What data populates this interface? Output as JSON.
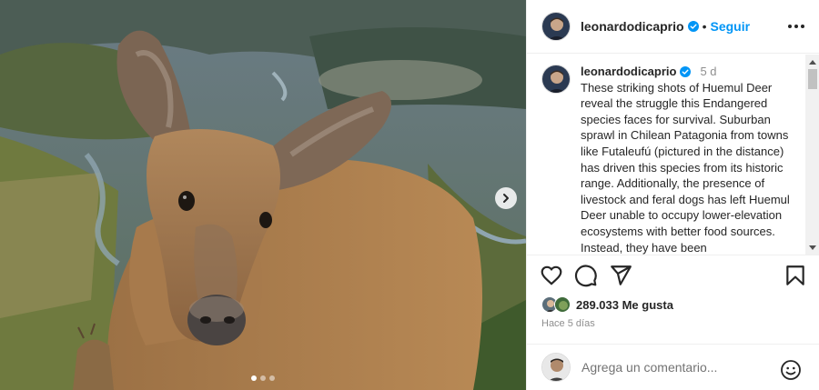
{
  "post": {
    "carousel": {
      "slides": 3,
      "active_index": 0
    }
  },
  "header": {
    "username": "leonardodicaprio",
    "separator": "•",
    "follow_label": "Seguir"
  },
  "caption": {
    "username": "leonardodicaprio",
    "age": "5 d",
    "text": "These striking shots of Huemul Deer reveal the struggle this Endangered species faces for survival. Suburban sprawl in Chilean Patagonia from towns like Futaleufú (pictured in the distance) has driven this species from its historic range. Additionally, the presence of livestock and feral dogs has left Huemul Deer unable to occupy lower-elevation ecosystems with better food sources. Instead, they have been"
  },
  "actions": {
    "icons": [
      "heart-icon",
      "comment-icon",
      "share-icon",
      "bookmark-icon"
    ]
  },
  "likes": {
    "text": "289.033 Me gusta"
  },
  "posted": "Hace 5 días",
  "comment": {
    "placeholder": "Agrega un comentario..."
  },
  "colors": {
    "accent": "#0095f6",
    "text": "#262626",
    "muted": "#8e8e8e",
    "border": "#efefef"
  }
}
